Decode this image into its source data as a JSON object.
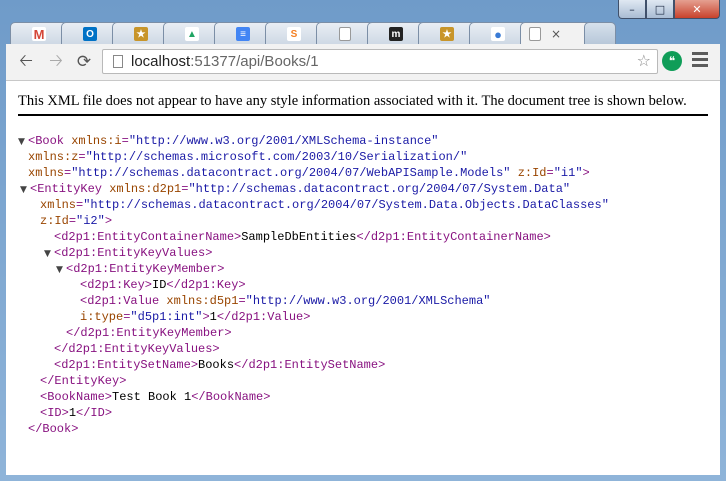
{
  "browser": {
    "url_host": "localhost",
    "url_path": ":51377/api/Books/1",
    "tabs": [
      {
        "icon": "gmail-icon",
        "label": "M",
        "color": "#d44638"
      },
      {
        "icon": "outlook-icon",
        "label": "O",
        "color": "#0072c6"
      },
      {
        "icon": "badge-icon",
        "label": "★",
        "color": "#c8952a"
      },
      {
        "icon": "drive-icon",
        "label": "▲",
        "color": "#1fa463"
      },
      {
        "icon": "docs-icon",
        "label": "≡",
        "color": "#4285f4"
      },
      {
        "icon": "stackoverflow-icon",
        "label": "S",
        "color": "#f48024"
      },
      {
        "icon": "document-icon",
        "label": "",
        "color": "#ffffff"
      },
      {
        "icon": "medium-icon",
        "label": "m",
        "color": "#222222"
      },
      {
        "icon": "badge-icon",
        "label": "★",
        "color": "#c8952a"
      },
      {
        "icon": "globe-icon",
        "label": "●",
        "color": "#3a7bd5"
      }
    ],
    "active_tab_close": "×"
  },
  "page": {
    "notice": "This XML file does not appear to have any style information associated with it. The document tree is shown below."
  },
  "xml": {
    "l1_tag": "<Book ",
    "l1_attr": "xmlns:i",
    "l1_val": "\"http://www.w3.org/2001/XMLSchema-instance\"",
    "l2_attr": "xmlns:z",
    "l2_val": "\"http://schemas.microsoft.com/2003/10/Serialization/\"",
    "l3_attr": "xmlns",
    "l3_val": "\"http://schemas.datacontract.org/2004/07/WebAPISample.Models\"",
    "l3_attr2": "z:Id",
    "l3_val2": "\"i1\"",
    "l4_tag": "<EntityKey ",
    "l4_attr": "xmlns:d2p1",
    "l4_val": "\"http://schemas.datacontract.org/2004/07/System.Data\"",
    "l5_attr": "xmlns",
    "l5_val": "\"http://schemas.datacontract.org/2004/07/System.Data.Objects.DataClasses\"",
    "l6_attr": "z:Id",
    "l6_val": "\"i2\"",
    "l7_open": "<d2p1:EntityContainerName>",
    "l7_text": "SampleDbEntities",
    "l7_close": "</d2p1:EntityContainerName>",
    "l8_tag": "<d2p1:EntityKeyValues>",
    "l9_tag": "<d2p1:EntityKeyMember>",
    "l10_open": "<d2p1:Key>",
    "l10_text": "ID",
    "l10_close": "</d2p1:Key>",
    "l11_tag": "<d2p1:Value ",
    "l11_attr": "xmlns:d5p1",
    "l11_val": "\"http://www.w3.org/2001/XMLSchema\"",
    "l12_attr": "i:type",
    "l12_val": "\"d5p1:int\"",
    "l12_text": "1",
    "l12_close": "</d2p1:Value>",
    "l13_tag": "</d2p1:EntityKeyMember>",
    "l14_tag": "</d2p1:EntityKeyValues>",
    "l15_open": "<d2p1:EntitySetName>",
    "l15_text": "Books",
    "l15_close": "</d2p1:EntitySetName>",
    "l16_tag": "</EntityKey>",
    "l17_open": "<BookName>",
    "l17_text": "Test Book 1",
    "l17_close": "</BookName>",
    "l18_open": "<ID>",
    "l18_text": "1",
    "l18_close": "</ID>",
    "l19_tag": "</Book>"
  }
}
